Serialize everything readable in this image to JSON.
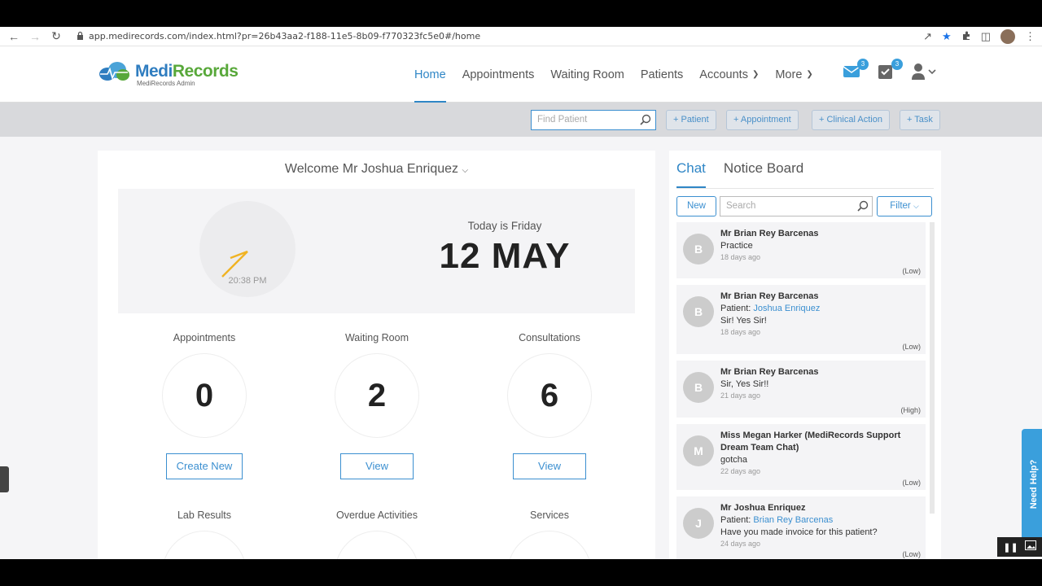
{
  "browser": {
    "url": "app.medirecords.com/index.html?pr=26b43aa2-f188-11e5-8b09-f770323fc5e0#/home"
  },
  "app": {
    "brand_part1": "Medi",
    "brand_part2": "Records",
    "brand_sub": "MediRecords Admin",
    "nav": [
      "Home",
      "Appointments",
      "Waiting Room",
      "Patients",
      "Accounts",
      "More"
    ],
    "mail_badge": "3",
    "tasks_badge": "3"
  },
  "toolbar": {
    "find_placeholder": "Find Patient",
    "add_patient": "+ Patient",
    "add_appointment": "+ Appointment",
    "add_clinical": "+ Clinical Action",
    "add_task": "+ Task"
  },
  "dashboard": {
    "welcome": "Welcome Mr Joshua Enriquez",
    "clock_time": "20:38 PM",
    "today_label": "Today is Friday",
    "date": "12 MAY",
    "stats": [
      {
        "label": "Appointments",
        "value": "0",
        "button": "Create New"
      },
      {
        "label": "Waiting Room",
        "value": "2",
        "button": "View"
      },
      {
        "label": "Consultations",
        "value": "6",
        "button": "View"
      },
      {
        "label": "Lab Results"
      },
      {
        "label": "Overdue Activities"
      },
      {
        "label": "Services"
      }
    ]
  },
  "chat": {
    "tab_chat": "Chat",
    "tab_notice": "Notice Board",
    "new_label": "New",
    "search_placeholder": "Search",
    "filter_label": "Filter",
    "messages": [
      {
        "initial": "B",
        "name": "Mr Brian Rey Barcenas",
        "text": "Practice",
        "ago": "18 days ago",
        "priority": "(Low)"
      },
      {
        "initial": "B",
        "name": "Mr Brian Rey Barcenas",
        "patient_label": "Patient:",
        "patient": "Joshua Enriquez",
        "text": "Sir! Yes Sir!",
        "ago": "18 days ago",
        "priority": "(Low)"
      },
      {
        "initial": "B",
        "name": "Mr Brian Rey Barcenas",
        "text": "Sir, Yes Sir!!",
        "ago": "21 days ago",
        "priority": "(High)"
      },
      {
        "initial": "M",
        "name": "Miss Megan Harker (MediRecords Support Dream Team Chat)",
        "text": "gotcha",
        "ago": "22 days ago",
        "priority": "(Low)"
      },
      {
        "initial": "J",
        "name": "Mr Joshua Enriquez",
        "patient_label": "Patient:",
        "patient": "Brian Rey Barcenas",
        "text": "Have you made invoice for this patient?",
        "ago": "24 days ago",
        "priority": "(Low)"
      }
    ]
  },
  "help": {
    "label": "Need Help?"
  }
}
